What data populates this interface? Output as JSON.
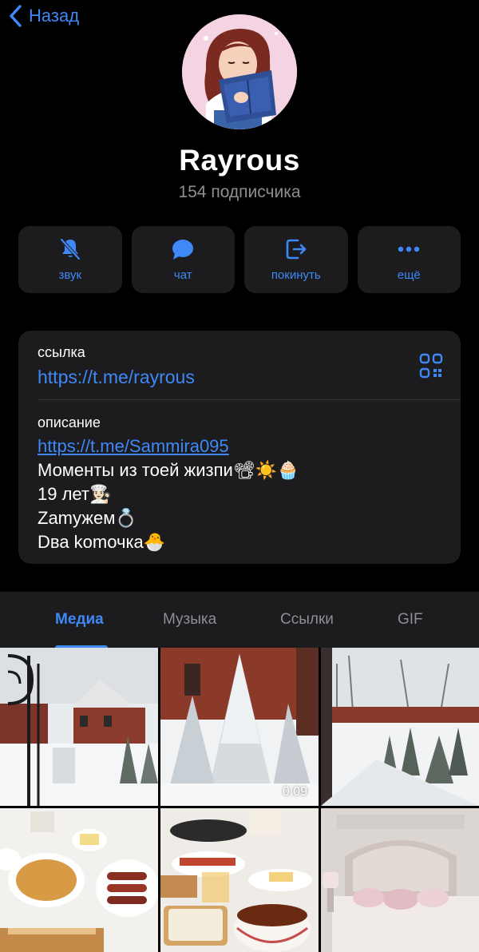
{
  "nav": {
    "back_label": "Назад"
  },
  "channel": {
    "name": "Rayrous",
    "subscribers": "154 подписчика"
  },
  "actions": [
    {
      "label": "звук",
      "icon": "bell-slash-icon"
    },
    {
      "label": "чат",
      "icon": "chat-bubble-icon"
    },
    {
      "label": "покинуть",
      "icon": "leave-icon"
    },
    {
      "label": "ещё",
      "icon": "more-dots-icon"
    }
  ],
  "info": {
    "link_label": "ссылка",
    "link_value": "https://t.me/rayrous",
    "description_label": "описание",
    "description_link": "https://t.me/Sammira095",
    "description_lines": [
      "Моменты из тоей жизпи📽☀️🧁",
      "19 лет👩🏻‍🍳",
      "Zаmужем💍",
      " Dва kоmочка🐣"
    ]
  },
  "tabs": [
    {
      "label": "Медиа",
      "active": true
    },
    {
      "label": "Музыка",
      "active": false
    },
    {
      "label": "Ссылки",
      "active": false
    },
    {
      "label": "GIF",
      "active": false
    }
  ],
  "media": {
    "video_duration": "0:09"
  },
  "colors": {
    "accent": "#3e88f7",
    "background": "#000000",
    "card": "#1c1c1e",
    "secondary_text": "#8e8e93"
  }
}
